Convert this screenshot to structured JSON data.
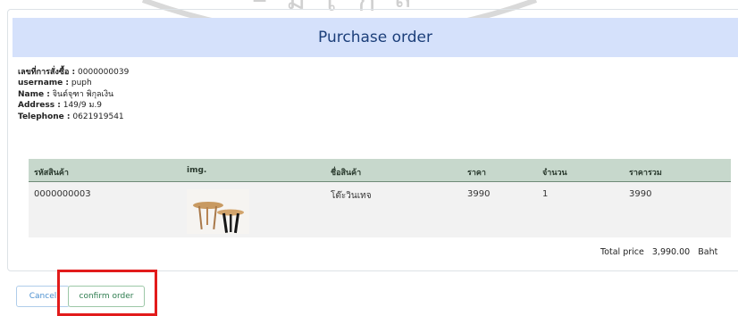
{
  "header": {
    "title": "Purchase order"
  },
  "order_info": {
    "order_no_label": "เลขที่การสั่งซื้อ :",
    "order_no": "0000000039",
    "username_label": "username :",
    "username": "puph",
    "name_label": "Name :",
    "name": "จินต์จุฑา พิกุลเงิน",
    "address_label": "Address :",
    "address": "149/9 ม.9",
    "telephone_label": "Telephone :",
    "telephone": "0621919541"
  },
  "table": {
    "headers": [
      "รหัสสินค้า",
      "img.",
      "ชื่อสินค้า",
      "ราคา",
      "จำนวน",
      "ราคารวม"
    ],
    "rows": [
      {
        "code": "0000000003",
        "name": "โต๊ะวินเทจ",
        "price": "3990",
        "qty": "1",
        "subtotal": "3990"
      }
    ]
  },
  "total": {
    "label": "Total price",
    "value": "3,990.00",
    "unit": "Baht"
  },
  "buttons": {
    "cancel": "Cancel",
    "confirm": "confirm order"
  },
  "colors": {
    "highlight": "#e21b1b",
    "header_bg": "#d5e1fb",
    "table_head_bg": "#c7d8cc"
  }
}
